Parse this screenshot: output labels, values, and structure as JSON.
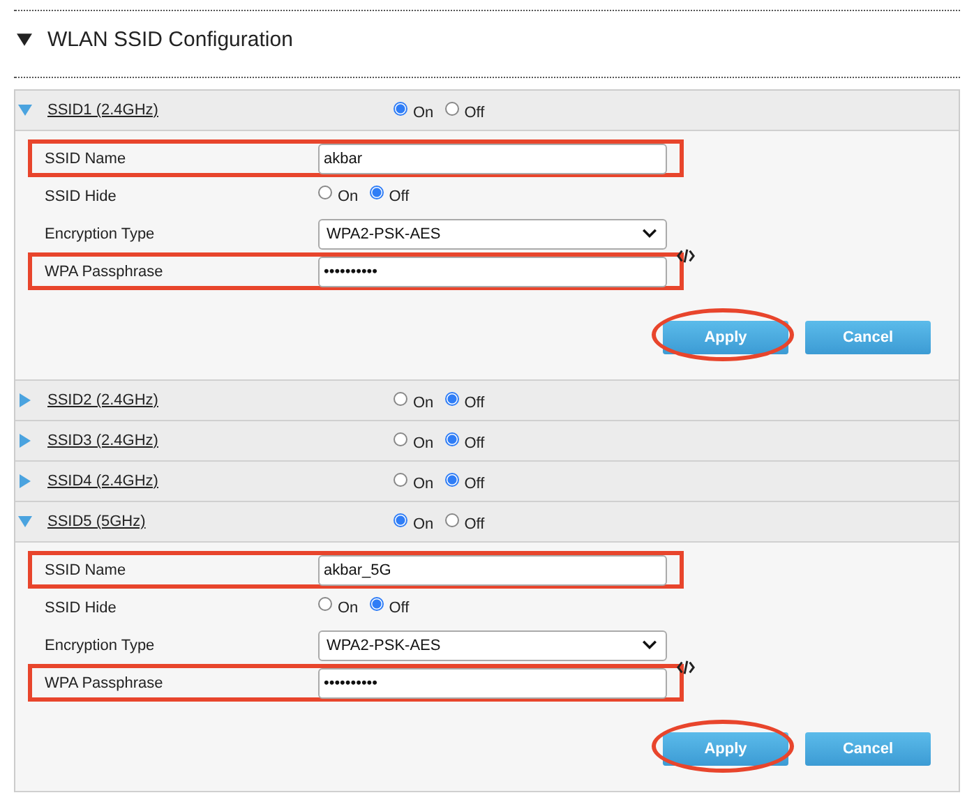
{
  "section": {
    "title": "WLAN SSID Configuration",
    "expanded": true
  },
  "ssids": [
    {
      "label": "SSID1 (2.4GHz)",
      "expanded": true,
      "options": [
        {
          "label": "On",
          "selected": true
        },
        {
          "label": "Off",
          "selected": false
        }
      ],
      "fields": [
        {
          "kind": "text",
          "label": "SSID Name",
          "value": "akbar",
          "highlighted": true
        },
        {
          "kind": "radio",
          "label": "SSID Hide",
          "options": [
            {
              "label": "On",
              "selected": false
            },
            {
              "label": "Off",
              "selected": true
            }
          ],
          "highlighted": false
        },
        {
          "kind": "select",
          "label": "Encryption Type",
          "value": "WPA2-PSK-AES",
          "highlighted": false
        },
        {
          "kind": "password",
          "label": "WPA Passphrase",
          "value": "••••••••••",
          "highlighted": true
        }
      ],
      "buttons": [
        {
          "label": "Apply",
          "circled": true
        },
        {
          "label": "Cancel",
          "circled": false
        }
      ]
    },
    {
      "label": "SSID2 (2.4GHz)",
      "expanded": false,
      "options": [
        {
          "label": "On",
          "selected": false
        },
        {
          "label": "Off",
          "selected": true
        }
      ]
    },
    {
      "label": "SSID3 (2.4GHz)",
      "expanded": false,
      "options": [
        {
          "label": "On",
          "selected": false
        },
        {
          "label": "Off",
          "selected": true
        }
      ]
    },
    {
      "label": "SSID4 (2.4GHz)",
      "expanded": false,
      "options": [
        {
          "label": "On",
          "selected": false
        },
        {
          "label": "Off",
          "selected": true
        }
      ]
    },
    {
      "label": "SSID5 (5GHz)",
      "expanded": true,
      "options": [
        {
          "label": "On",
          "selected": true
        },
        {
          "label": "Off",
          "selected": false
        }
      ],
      "fields": [
        {
          "kind": "text",
          "label": "SSID Name",
          "value": "akbar_5G",
          "highlighted": true
        },
        {
          "kind": "radio",
          "label": "SSID Hide",
          "options": [
            {
              "label": "On",
              "selected": false
            },
            {
              "label": "Off",
              "selected": true
            }
          ],
          "highlighted": false
        },
        {
          "kind": "select",
          "label": "Encryption Type",
          "value": "WPA2-PSK-AES",
          "highlighted": false
        },
        {
          "kind": "password",
          "label": "WPA Passphrase",
          "value": "••••••••••",
          "highlighted": true
        }
      ],
      "buttons": [
        {
          "label": "Apply",
          "circled": true
        },
        {
          "label": "Cancel",
          "circled": false
        }
      ]
    }
  ]
}
